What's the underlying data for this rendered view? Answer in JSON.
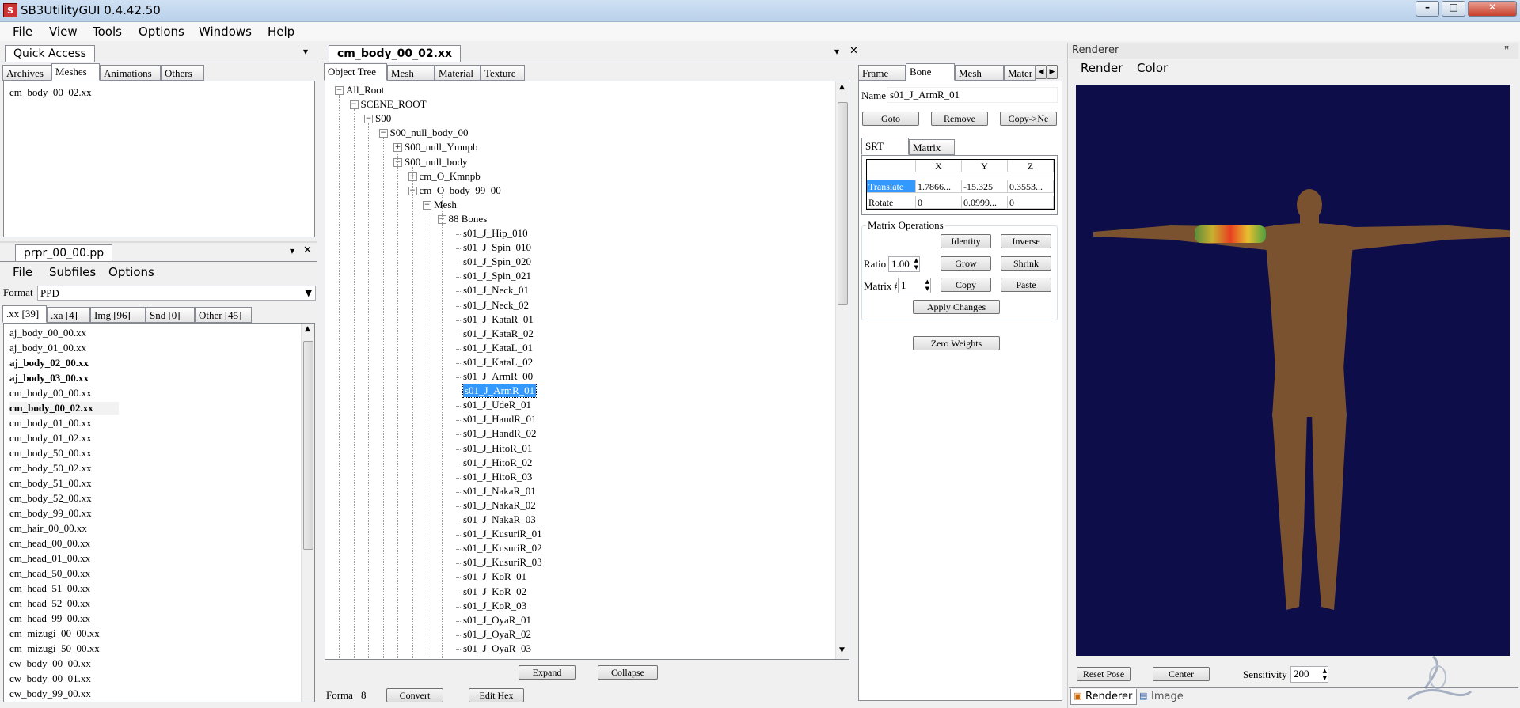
{
  "window": {
    "title": "SB3UtilityGUI 0.4.42.50",
    "icon_label": "S"
  },
  "menubar": [
    "File",
    "View",
    "Tools",
    "Options",
    "Windows",
    "Help"
  ],
  "quick_access": {
    "title": "Quick Access",
    "tabs": [
      "Archives",
      "Meshes",
      "Animations",
      "Others"
    ],
    "items": [
      "cm_body_00_02.xx"
    ]
  },
  "pp_panel": {
    "title": "prpr_00_00.pp",
    "menu": [
      "File",
      "Subfiles",
      "Options"
    ],
    "format_label": "Format",
    "format_value": "PPD",
    "tabs": [
      ".xx [39]",
      ".xa [4]",
      "Img [96]",
      "Snd [0]",
      "Other [45]"
    ],
    "files": [
      {
        "name": "aj_body_00_00.xx",
        "bold": false
      },
      {
        "name": "aj_body_01_00.xx",
        "bold": false
      },
      {
        "name": "aj_body_02_00.xx",
        "bold": true
      },
      {
        "name": "aj_body_03_00.xx",
        "bold": true
      },
      {
        "name": "cm_body_00_00.xx",
        "bold": false
      },
      {
        "name": "cm_body_00_02.xx",
        "bold": true
      },
      {
        "name": "cm_body_01_00.xx",
        "bold": false
      },
      {
        "name": "cm_body_01_02.xx",
        "bold": false
      },
      {
        "name": "cm_body_50_00.xx",
        "bold": false
      },
      {
        "name": "cm_body_50_02.xx",
        "bold": false
      },
      {
        "name": "cm_body_51_00.xx",
        "bold": false
      },
      {
        "name": "cm_body_52_00.xx",
        "bold": false
      },
      {
        "name": "cm_body_99_00.xx",
        "bold": false
      },
      {
        "name": "cm_hair_00_00.xx",
        "bold": false
      },
      {
        "name": "cm_head_00_00.xx",
        "bold": false
      },
      {
        "name": "cm_head_01_00.xx",
        "bold": false
      },
      {
        "name": "cm_head_50_00.xx",
        "bold": false
      },
      {
        "name": "cm_head_51_00.xx",
        "bold": false
      },
      {
        "name": "cm_head_52_00.xx",
        "bold": false
      },
      {
        "name": "cm_head_99_00.xx",
        "bold": false
      },
      {
        "name": "cm_mizugi_00_00.xx",
        "bold": false
      },
      {
        "name": "cm_mizugi_50_00.xx",
        "bold": false
      },
      {
        "name": "cw_body_00_00.xx",
        "bold": false
      },
      {
        "name": "cw_body_00_01.xx",
        "bold": false
      },
      {
        "name": "cw_body_99_00.xx",
        "bold": false
      }
    ]
  },
  "editor": {
    "doc_tab": "cm_body_00_02.xx",
    "tabs": [
      "Object Tree",
      "Mesh",
      "Material",
      "Texture"
    ],
    "tree": [
      {
        "label": "All_Root",
        "level": 0,
        "exp": "-"
      },
      {
        "label": "SCENE_ROOT",
        "level": 1,
        "exp": "-"
      },
      {
        "label": "S00",
        "level": 2,
        "exp": "-"
      },
      {
        "label": "S00_null_body_00",
        "level": 3,
        "exp": "-"
      },
      {
        "label": "S00_null_Ymnpb",
        "level": 4,
        "exp": "+"
      },
      {
        "label": "S00_null_body",
        "level": 4,
        "exp": "-"
      },
      {
        "label": "cm_O_Kmnpb",
        "level": 5,
        "exp": "+"
      },
      {
        "label": "cm_O_body_99_00",
        "level": 5,
        "exp": "-"
      },
      {
        "label": "Mesh",
        "level": 6,
        "exp": "-"
      },
      {
        "label": "88 Bones",
        "level": 7,
        "exp": "-"
      },
      {
        "label": "s01_J_Hip_010",
        "level": 8,
        "exp": ""
      },
      {
        "label": "s01_J_Spin_010",
        "level": 8,
        "exp": ""
      },
      {
        "label": "s01_J_Spin_020",
        "level": 8,
        "exp": ""
      },
      {
        "label": "s01_J_Spin_021",
        "level": 8,
        "exp": ""
      },
      {
        "label": "s01_J_Neck_01",
        "level": 8,
        "exp": ""
      },
      {
        "label": "s01_J_Neck_02",
        "level": 8,
        "exp": ""
      },
      {
        "label": "s01_J_KataR_01",
        "level": 8,
        "exp": ""
      },
      {
        "label": "s01_J_KataR_02",
        "level": 8,
        "exp": ""
      },
      {
        "label": "s01_J_KataL_01",
        "level": 8,
        "exp": ""
      },
      {
        "label": "s01_J_KataL_02",
        "level": 8,
        "exp": ""
      },
      {
        "label": "s01_J_ArmR_00",
        "level": 8,
        "exp": ""
      },
      {
        "label": "s01_J_ArmR_01",
        "level": 8,
        "exp": "",
        "selected": true
      },
      {
        "label": "s01_J_UdeR_01",
        "level": 8,
        "exp": ""
      },
      {
        "label": "s01_J_HandR_01",
        "level": 8,
        "exp": ""
      },
      {
        "label": "s01_J_HandR_02",
        "level": 8,
        "exp": ""
      },
      {
        "label": "s01_J_HitoR_01",
        "level": 8,
        "exp": ""
      },
      {
        "label": "s01_J_HitoR_02",
        "level": 8,
        "exp": ""
      },
      {
        "label": "s01_J_HitoR_03",
        "level": 8,
        "exp": ""
      },
      {
        "label": "s01_J_NakaR_01",
        "level": 8,
        "exp": ""
      },
      {
        "label": "s01_J_NakaR_02",
        "level": 8,
        "exp": ""
      },
      {
        "label": "s01_J_NakaR_03",
        "level": 8,
        "exp": ""
      },
      {
        "label": "s01_J_KusuriR_01",
        "level": 8,
        "exp": ""
      },
      {
        "label": "s01_J_KusuriR_02",
        "level": 8,
        "exp": ""
      },
      {
        "label": "s01_J_KusuriR_03",
        "level": 8,
        "exp": ""
      },
      {
        "label": "s01_J_KoR_01",
        "level": 8,
        "exp": ""
      },
      {
        "label": "s01_J_KoR_02",
        "level": 8,
        "exp": ""
      },
      {
        "label": "s01_J_KoR_03",
        "level": 8,
        "exp": ""
      },
      {
        "label": "s01_J_OyaR_01",
        "level": 8,
        "exp": ""
      },
      {
        "label": "s01_J_OyaR_02",
        "level": 8,
        "exp": ""
      },
      {
        "label": "s01_J_OyaR_03",
        "level": 8,
        "exp": ""
      }
    ],
    "expand_label": "Expand",
    "collapse_label": "Collapse",
    "format_label": "Forma",
    "format_value": "8",
    "convert_label": "Convert",
    "edit_hex_label": "Edit Hex"
  },
  "bone_panel": {
    "tabs": [
      "Frame",
      "Bone",
      "Mesh",
      "Mater"
    ],
    "name_label": "Name",
    "name_value": "s01_J_ArmR_01",
    "goto_label": "Goto",
    "remove_label": "Remove",
    "copy_label": "Copy->Ne",
    "srt_tabs": [
      "SRT",
      "Matrix"
    ],
    "columns": [
      "X",
      "Y",
      "Z"
    ],
    "rows": [
      {
        "label": "Translate",
        "values": [
          "1.7866...",
          "-15.325",
          "0.3553..."
        ]
      },
      {
        "label": "Rotate",
        "values": [
          "0",
          "0.0999...",
          "0"
        ]
      }
    ],
    "matrix_ops_label": "Matrix Operations",
    "identity_label": "Identity",
    "inverse_label": "Inverse",
    "ratio_label": "Ratio",
    "ratio_value": "1.00",
    "grow_label": "Grow",
    "shrink_label": "Shrink",
    "matrix_label": "Matrix #",
    "matrix_value": "1",
    "copy_btn_label": "Copy",
    "paste_label": "Paste",
    "apply_label": "Apply Changes",
    "zero_weights_label": "Zero Weights"
  },
  "renderer": {
    "title": "Renderer",
    "menu": [
      "Render",
      "Color"
    ],
    "reset_pose_label": "Reset Pose",
    "center_label": "Center",
    "sensitivity_label": "Sensitivity",
    "sensitivity_value": "200",
    "bottom_tabs": [
      "Renderer",
      "Image"
    ],
    "viewport_color": "#0d0d4a",
    "skin_color": "#7a5230"
  }
}
